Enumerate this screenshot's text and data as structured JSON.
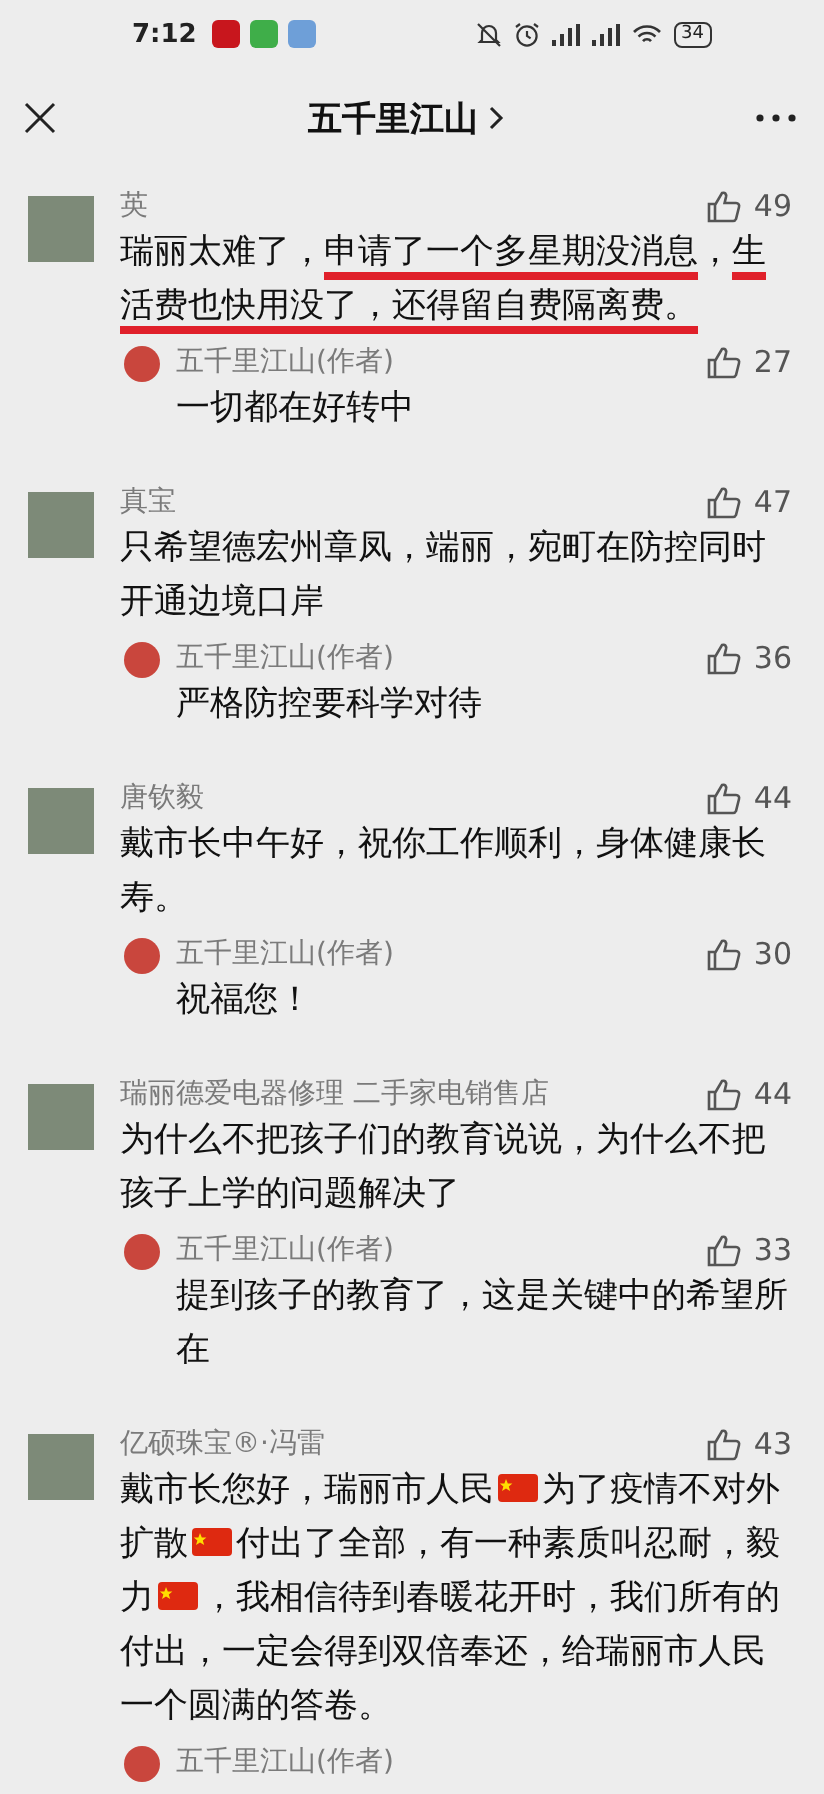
{
  "status_bar": {
    "time": "7:12",
    "battery": "34"
  },
  "header": {
    "title": "五千里江山"
  },
  "comments": [
    {
      "name": "英",
      "likes": "49",
      "body": [
        {
          "kind": "text",
          "text": "瑞丽太难了，",
          "underlined": false
        },
        {
          "kind": "text",
          "text": "申请了一个多星期没消息",
          "underlined": true
        },
        {
          "kind": "text",
          "text": "，",
          "underlined": false
        },
        {
          "kind": "text",
          "text": "生活费也快用没了，还得留自费隔离费。",
          "underlined": true
        }
      ],
      "reply": {
        "name": "五千里江山(作者)",
        "likes": "27",
        "body": "一切都在好转中"
      }
    },
    {
      "name": "真宝",
      "likes": "47",
      "body": [
        {
          "kind": "text",
          "text": "只希望德宏州章凤，端丽，宛町在防控同时开通边境口岸",
          "underlined": false
        }
      ],
      "reply": {
        "name": "五千里江山(作者)",
        "likes": "36",
        "body": "严格防控要科学对待"
      }
    },
    {
      "name": "唐钦毅",
      "likes": "44",
      "body": [
        {
          "kind": "text",
          "text": "戴市长中午好，祝你工作顺利，身体健康长寿。",
          "underlined": false
        }
      ],
      "reply": {
        "name": "五千里江山(作者)",
        "likes": "30",
        "body": "祝福您！"
      }
    },
    {
      "name": "瑞丽德爱电器修理 二手家电销售店",
      "likes": "44",
      "body": [
        {
          "kind": "text",
          "text": "为什么不把孩子们的教育说说，为什么不把孩子上学的问题解决了",
          "underlined": false
        }
      ],
      "reply": {
        "name": "五千里江山(作者)",
        "likes": "33",
        "body": "提到孩子的教育了，这是关键中的希望所在"
      }
    },
    {
      "name": "亿硕珠宝®·冯雷",
      "likes": "43",
      "body": [
        {
          "kind": "text",
          "text": "戴市长您好，瑞丽市人民",
          "underlined": false
        },
        {
          "kind": "flag"
        },
        {
          "kind": "text",
          "text": "为了疫情不对外扩散",
          "underlined": false
        },
        {
          "kind": "flag"
        },
        {
          "kind": "text",
          "text": "付出了全部，有一种素质叫忍耐，毅力",
          "underlined": false
        },
        {
          "kind": "flag"
        },
        {
          "kind": "text",
          "text": "，我相信待到春暖花开时，我们所有的付出，一定会得到双倍奉还，给瑞丽市人民一个圆满的答卷。",
          "underlined": false
        }
      ],
      "reply": {
        "name": "五千里江山(作者)"
      }
    }
  ]
}
